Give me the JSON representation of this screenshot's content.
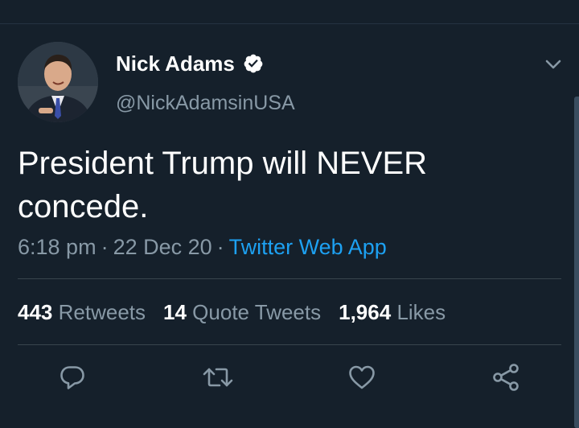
{
  "tweet": {
    "author": {
      "display_name": "Nick Adams",
      "handle": "@NickAdamsinUSA",
      "verified": true
    },
    "text_line1": "President Trump will NEVER",
    "text_line2": "concede.",
    "time": "6:18 pm",
    "date": "22 Dec 20",
    "separator": "·",
    "source": "Twitter Web App"
  },
  "stats": {
    "retweets_count": "443",
    "retweets_label": "Retweets",
    "quote_tweets_count": "14",
    "quote_tweets_label": "Quote Tweets",
    "likes_count": "1,964",
    "likes_label": "Likes"
  },
  "icons": {
    "verified": "verified-badge-icon",
    "menu": "chevron-down-icon",
    "reply": "reply-icon",
    "retweet": "retweet-icon",
    "like": "heart-icon",
    "share": "share-icon"
  },
  "colors": {
    "background": "#15202b",
    "accent": "#1da1f2",
    "secondary_text": "#8899a6",
    "divider": "#38444d"
  }
}
